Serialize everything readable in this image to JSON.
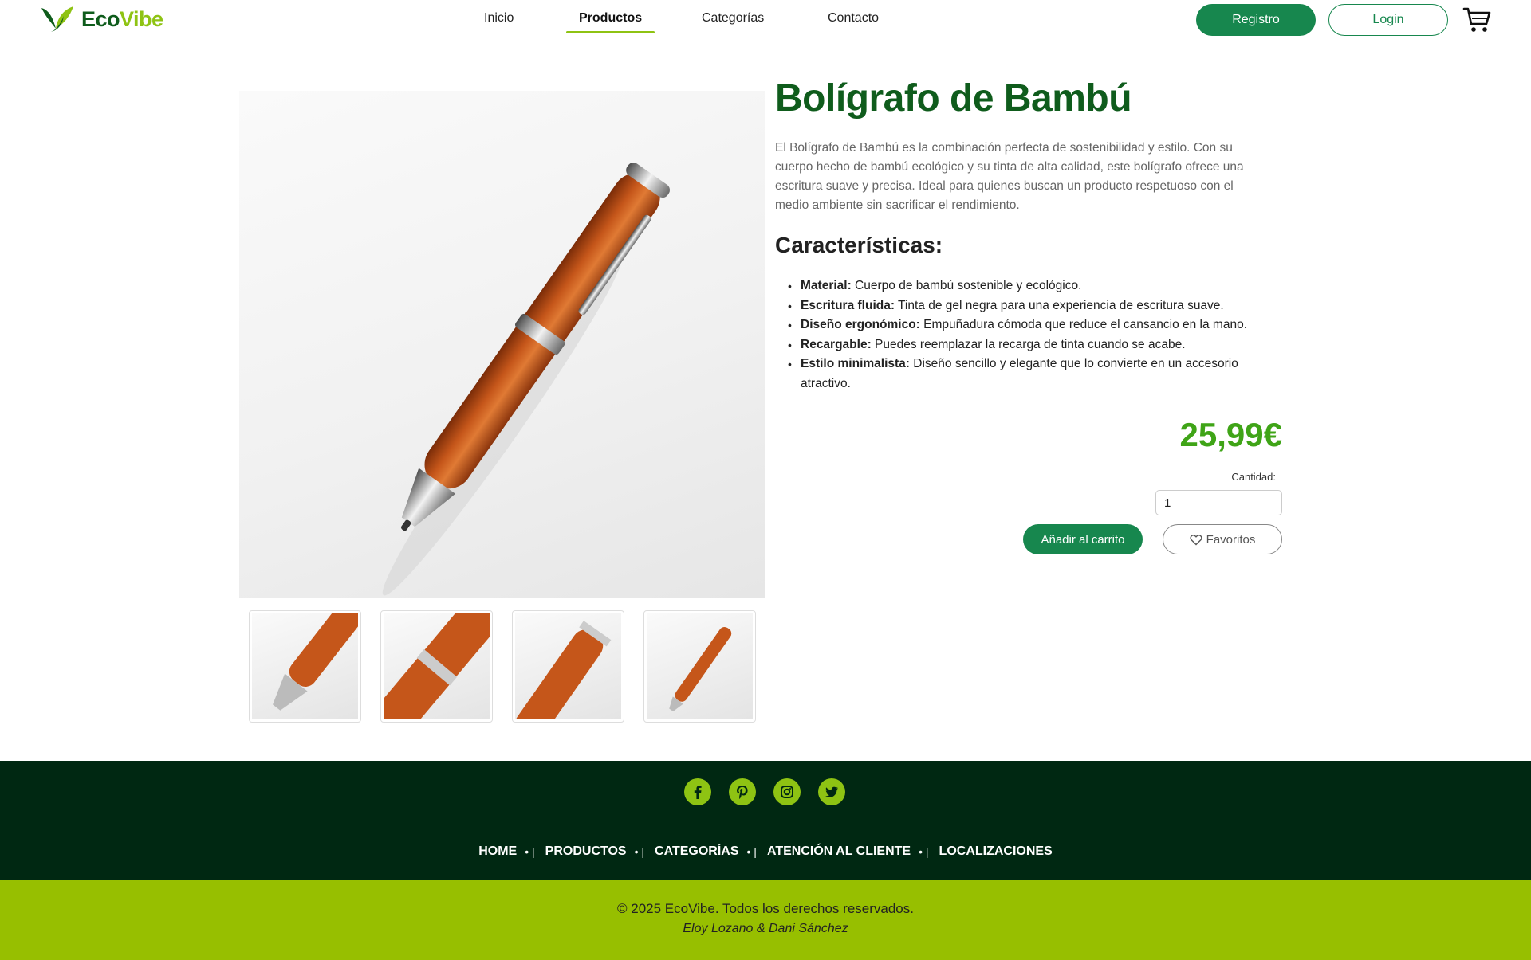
{
  "brand": {
    "name_part1": "Eco",
    "name_part2": "Vibe",
    "color_primary": "#0f5c1c",
    "color_accent": "#8ec313"
  },
  "nav": {
    "items": [
      {
        "label": "Inicio",
        "active": false
      },
      {
        "label": "Productos",
        "active": true
      },
      {
        "label": "Categorías",
        "active": false
      },
      {
        "label": "Contacto",
        "active": false
      }
    ]
  },
  "header": {
    "register_label": "Registro",
    "login_label": "Login",
    "cart_icon": "cart-icon"
  },
  "product": {
    "title": "Bolígrafo de Bambú",
    "description": "El Bolígrafo de Bambú es la combinación perfecta de sostenibilidad y estilo. Con su cuerpo hecho de bambú ecológico y su tinta de alta calidad, este bolígrafo ofrece una escritura suave y precisa. Ideal para quienes buscan un producto respetuoso con el medio ambiente sin sacrificar el rendimiento.",
    "features_title": "Características:",
    "features": [
      {
        "name": "Material:",
        "text": " Cuerpo de bambú sostenible y ecológico."
      },
      {
        "name": "Escritura fluida:",
        "text": " Tinta de gel negra para una experiencia de escritura suave."
      },
      {
        "name": "Diseño ergonómico:",
        "text": " Empuñadura cómoda que reduce el cansancio en la mano."
      },
      {
        "name": "Recargable:",
        "text": " Puedes reemplazar la recarga de tinta cuando se acabe."
      },
      {
        "name": "Estilo minimalista:",
        "text": " Diseño sencillo y elegante que lo convierte en un accesorio atractivo."
      }
    ],
    "price": "25,99€",
    "quantity_label": "Cantidad:",
    "quantity_value": "1",
    "add_to_cart_label": "Añadir al carrito",
    "favorites_label": "Favoritos",
    "price_color": "#3fa417"
  },
  "footer": {
    "socials": [
      "facebook-icon",
      "pinterest-icon",
      "instagram-icon",
      "twitter-icon"
    ],
    "links": [
      "HOME",
      "PRODUCTOS",
      "CATEGORÍAS",
      "ATENCIÓN AL CLIENTE",
      "LOCALIZACIONES"
    ],
    "separator": "• |",
    "copyright": "© 2025 EcoVibe. Todos los derechos reservados.",
    "authors": "Eloy Lozano & Dani Sánchez",
    "color_dark": "#002812",
    "color_light": "#97bf00"
  }
}
